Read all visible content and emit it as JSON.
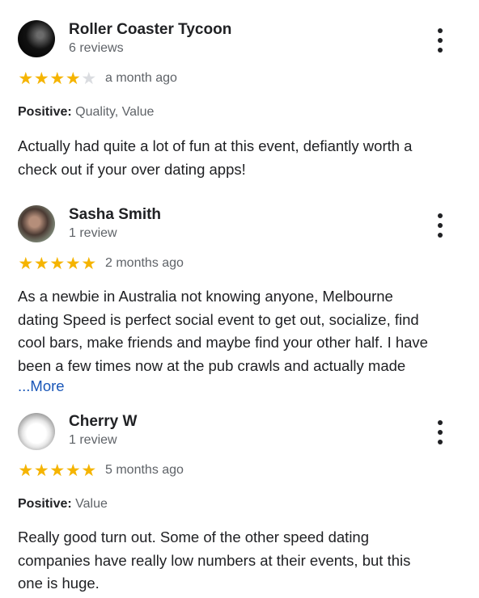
{
  "reviews": [
    {
      "author": "Roller Coaster Tycoon",
      "review_count": "6 reviews",
      "rating": 4,
      "date": "a month ago",
      "highlight_label": "Positive:",
      "highlight_values": "Quality, Value",
      "body_lines": [
        "Actually had quite a lot of fun at this event, defiantly worth a",
        "check out if your over dating apps!"
      ]
    },
    {
      "author": "Sasha Smith",
      "review_count": "1 review",
      "rating": 5,
      "date": "2 months ago",
      "body_lines": [
        "As a newbie in Australia not knowing anyone, Melbourne",
        "dating Speed is perfect social event to get out, socialize, find",
        "cool bars, make friends and maybe find your other half. I have",
        "been a few times now at the pub crawls and actually made"
      ],
      "more_label": "...More"
    },
    {
      "author": "Cherry W",
      "review_count": "1 review",
      "rating": 5,
      "date": "5 months ago",
      "highlight_label": "Positive:",
      "highlight_values": "Value",
      "body_lines": [
        "Really good turn out. Some of the other speed dating",
        "companies have really low numbers at their events, but this",
        "one is huge."
      ]
    }
  ],
  "icons": {
    "star": "star-icon",
    "menu": "more-vert-icon"
  },
  "colors": {
    "star_filled": "#f5b400",
    "star_empty": "#dadce0",
    "link": "#1a57b8",
    "secondary_text": "#5f6368"
  }
}
